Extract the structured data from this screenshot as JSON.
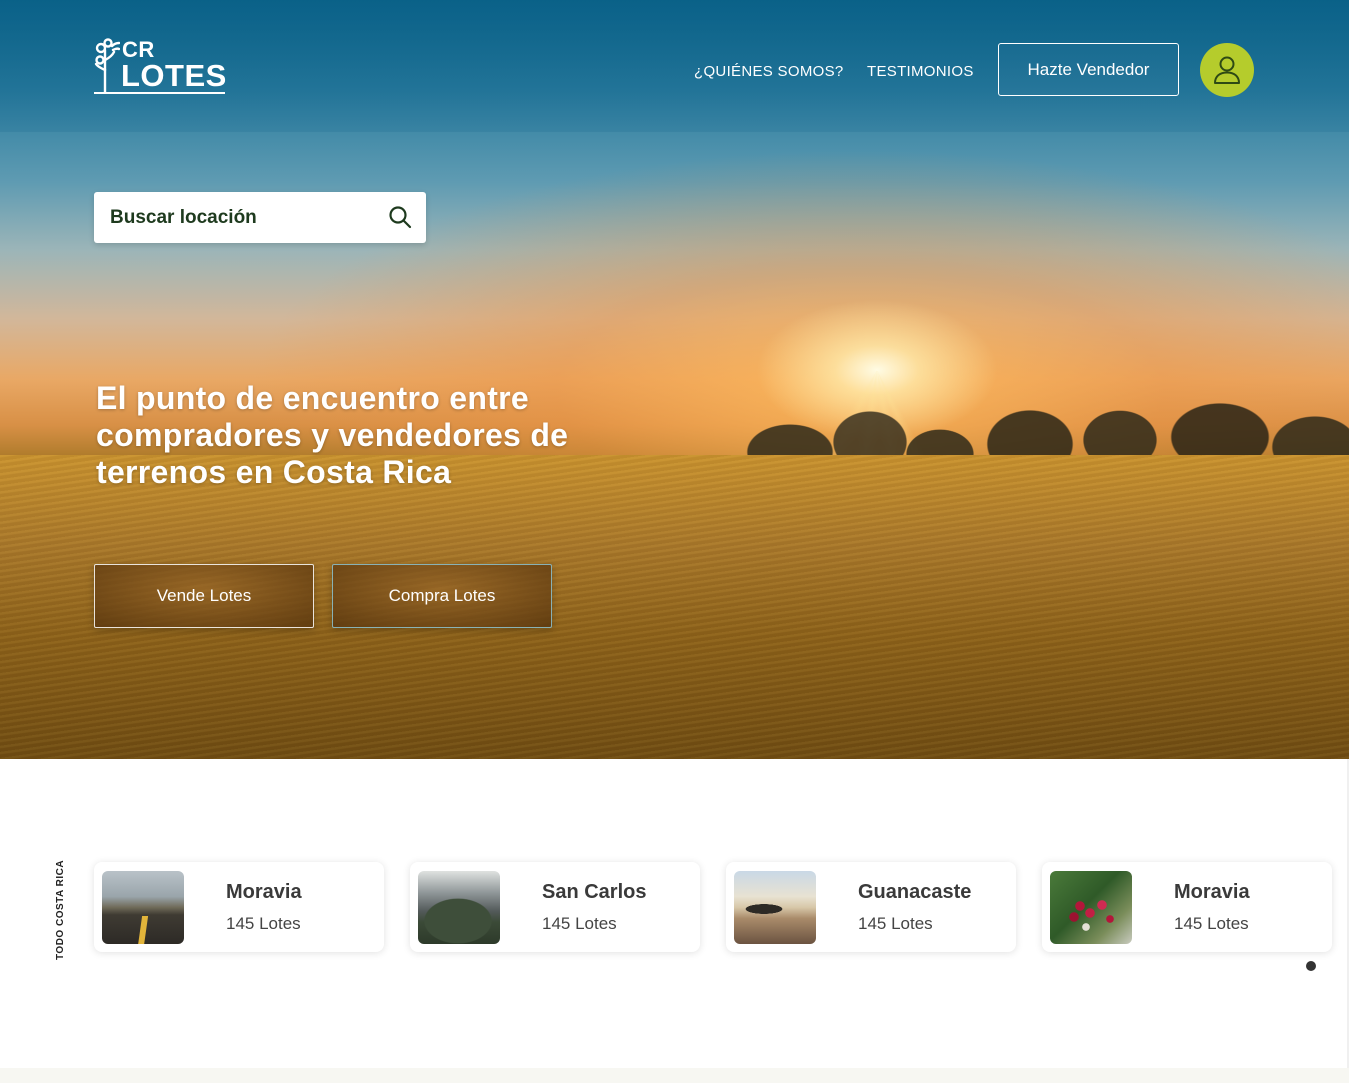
{
  "header": {
    "logo": {
      "top": "CR",
      "bottom": "LOTES"
    },
    "nav": [
      {
        "label": "¿QUIÉNES SOMOS?"
      },
      {
        "label": "TESTIMONIOS"
      }
    ],
    "seller_button": "Hazte Vendedor",
    "user_icon": "user-icon",
    "accent_color": "#b5cc2c"
  },
  "search": {
    "placeholder": "Buscar locación",
    "icon": "search-icon"
  },
  "hero": {
    "headline": "El punto de encuentro entre compradores y vendedores de terrenos en Costa Rica",
    "buttons": {
      "sell": "Vende Lotes",
      "buy": "Compra Lotes"
    }
  },
  "locations": {
    "side_label": "TODO COSTA RICA",
    "cards": [
      {
        "name": "Moravia",
        "count": "145 Lotes"
      },
      {
        "name": "San Carlos",
        "count": "145 Lotes"
      },
      {
        "name": "Guanacaste",
        "count": "145 Lotes"
      },
      {
        "name": "Moravia",
        "count": "145 Lotes"
      }
    ]
  }
}
